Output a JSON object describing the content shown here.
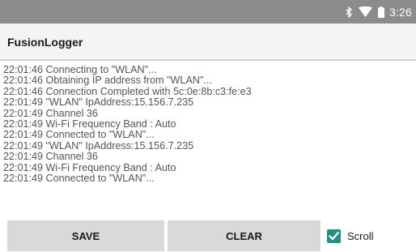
{
  "status_bar": {
    "time": "3:26",
    "icons": [
      "bluetooth-icon",
      "wifi-icon",
      "battery-icon"
    ]
  },
  "app": {
    "title": "FusionLogger"
  },
  "log": {
    "lines": [
      "22:01:46 Connecting to \"WLAN\"...",
      "22:01:46 Obtaining IP address from \"WLAN\"...",
      "22:01:46 Connection Completed with 5c:0e:8b:c3:fe:e3",
      "22:01:49 \"WLAN\" IpAddress:15.156.7.235",
      "22:01:49 Channel 36",
      "22:01:49 Wi-Fi Frequency Band : Auto",
      "22:01:49 Connected to \"WLAN\"...",
      "22:01:49 \"WLAN\" IpAddress:15.156.7.235",
      "22:01:49 Channel 36",
      "22:01:49 Wi-Fi Frequency Band : Auto",
      "22:01:49 Connected to \"WLAN\"..."
    ]
  },
  "actions": {
    "save_label": "SAVE",
    "clear_label": "CLEAR",
    "scroll_label": "Scroll",
    "scroll_checked": true
  },
  "colors": {
    "status_bar": "#8c8c8c",
    "app_bar": "#f4f4f4",
    "button": "#d9d9d9",
    "checkbox_accent": "#2a8d82",
    "log_text": "#555555"
  }
}
